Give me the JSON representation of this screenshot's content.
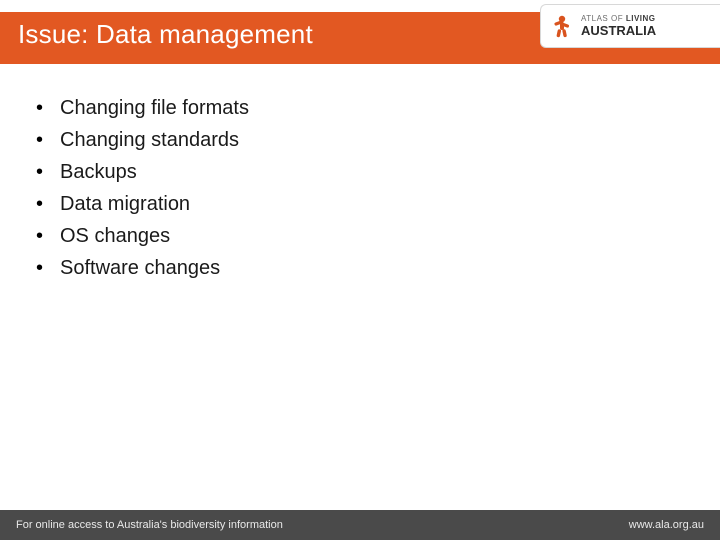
{
  "header": {
    "title": "Issue: Data management"
  },
  "logo": {
    "line1": "ATLAS OF",
    "line2_light": "LIVING",
    "line2_bold": "AUSTRALIA"
  },
  "bullets": [
    "Changing file formats",
    "Changing standards",
    "Backups",
    "Data migration",
    "OS changes",
    "Software changes"
  ],
  "footer": {
    "left": "For online access to Australia's biodiversity information",
    "right": "www.ala.org.au"
  },
  "colors": {
    "accent": "#e25822",
    "footer_bg": "#4a4a4a"
  }
}
